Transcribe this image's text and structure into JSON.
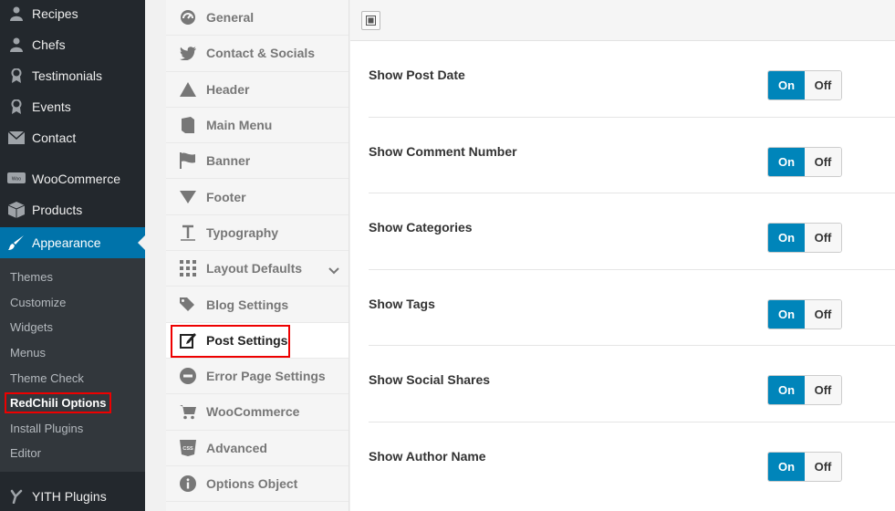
{
  "wp_menu": {
    "top_items": [
      {
        "label": "Recipes",
        "icon": "user-icon"
      },
      {
        "label": "Chefs",
        "icon": "user-icon"
      },
      {
        "label": "Testimonials",
        "icon": "award-icon"
      },
      {
        "label": "Events",
        "icon": "award-icon"
      },
      {
        "label": "Contact",
        "icon": "mail-icon"
      }
    ],
    "woo": {
      "label": "WooCommerce",
      "icon": "woo-icon"
    },
    "products": {
      "label": "Products",
      "icon": "box-icon"
    },
    "appearance": {
      "label": "Appearance",
      "icon": "brush-icon"
    },
    "submenu": [
      "Themes",
      "Customize",
      "Widgets",
      "Menus",
      "Theme Check",
      "RedChili Options",
      "Install Plugins",
      "Editor"
    ],
    "yith": {
      "label": "YITH Plugins",
      "icon": "yith-icon"
    }
  },
  "options_nav": {
    "items": [
      "General",
      "Contact & Socials",
      "Header",
      "Main Menu",
      "Banner",
      "Footer",
      "Typography",
      "Layout Defaults",
      "Blog Settings",
      "Post Settings",
      "Error Page Settings",
      "WooCommerce",
      "Advanced",
      "Options Object"
    ]
  },
  "settings": {
    "rows": [
      {
        "label": "Show Post Date",
        "on": "On",
        "off": "Off"
      },
      {
        "label": "Show Comment Number",
        "on": "On",
        "off": "Off"
      },
      {
        "label": "Show Categories",
        "on": "On",
        "off": "Off"
      },
      {
        "label": "Show Tags",
        "on": "On",
        "off": "Off"
      },
      {
        "label": "Show Social Shares",
        "on": "On",
        "off": "Off"
      },
      {
        "label": "Show Author Name",
        "on": "On",
        "off": "Off"
      }
    ]
  },
  "colors": {
    "accent": "#0085ba",
    "wp_active": "#0073aa",
    "highlight": "#ee0000"
  }
}
